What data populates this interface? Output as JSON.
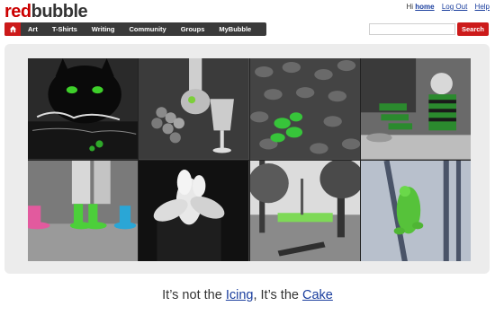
{
  "logo": {
    "red": "red",
    "dark": "bubble"
  },
  "header": {
    "greeting": "Hi",
    "username": "home",
    "logout": "Log Out",
    "help": "Help"
  },
  "nav": {
    "home_icon": "home-icon",
    "items": [
      "Art",
      "T-Shirts",
      "Writing",
      "Community",
      "Groups",
      "MyBubble"
    ]
  },
  "search": {
    "placeholder": "",
    "button": "Search"
  },
  "gallery": {
    "tiles": [
      "black-cat",
      "grapes-wine",
      "green-leaves",
      "boy-striped",
      "rain-boots",
      "white-flower",
      "park-bench",
      "tree-frog"
    ]
  },
  "caption": {
    "prefix": "It’s not the ",
    "link1": "Icing",
    "middle": ", It’s the ",
    "link2": "Cake"
  },
  "colors": {
    "brand": "#cc0000",
    "nav": "#3a3a3a",
    "link": "#1a3e9e"
  }
}
